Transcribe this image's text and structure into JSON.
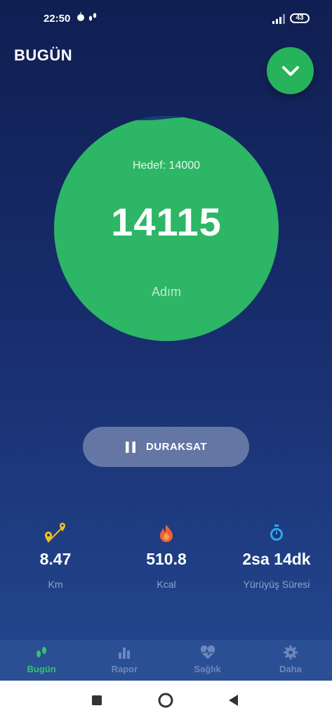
{
  "status_bar": {
    "time": "22:50",
    "battery_level": "43",
    "left_icons": "⏰ 👣"
  },
  "header": {
    "title": "BUGÜN"
  },
  "step_circle": {
    "goal_label": "Hedef: 14000",
    "steps": "14115",
    "unit": "Adım"
  },
  "pause_button": {
    "label": "DURAKSAT"
  },
  "stats": [
    {
      "value": "8.47",
      "label": "Km",
      "icon": "route-pin-icon"
    },
    {
      "value": "510.8",
      "label": "Kcal",
      "icon": "flame-icon"
    },
    {
      "value": "2sa 14dk",
      "label": "Yürüyüş Süresi",
      "icon": "stopwatch-icon"
    }
  ],
  "bottom_nav": [
    {
      "label": "Bugün",
      "icon": "footsteps-icon",
      "active": true
    },
    {
      "label": "Rapor",
      "icon": "bar-chart-icon",
      "active": false
    },
    {
      "label": "Sağlık",
      "icon": "heart-pulse-icon",
      "active": false
    },
    {
      "label": "Daha",
      "icon": "gear-icon",
      "active": false
    }
  ],
  "colors": {
    "accent_green": "#2cb665",
    "background_top": "#101f52",
    "background_bottom": "#254a94"
  }
}
